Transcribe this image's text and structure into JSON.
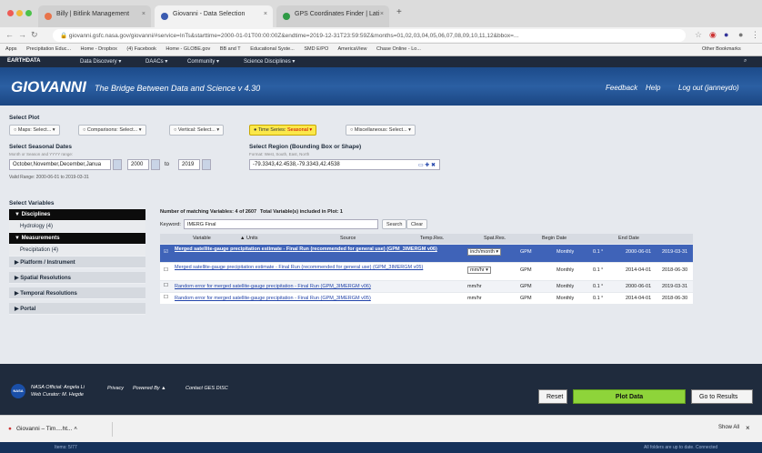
{
  "browser": {
    "tabs": [
      {
        "label": "Billy | Bitlink Management",
        "color": "#e8734a"
      },
      {
        "label": "Giovanni - Data Selection",
        "color": "#3b5bb0"
      },
      {
        "label": "GPS Coordinates Finder | Lati",
        "color": "#2e9a45"
      }
    ],
    "url": "giovanni.gsfc.nasa.gov/giovanni/#service=InTs&starttime=2000-01-01T00:00:00Z&endtime=2019-12-31T23:59:59Z&months=01,02,03,04,05,06,07,08,09,10,11,12&bbox=...",
    "bookmarks": [
      "Apps",
      "Precipitation Educ...",
      "Home - Dropbox",
      "(4) Facebook",
      "Home - GLOBE.gov",
      "BB and T",
      "Educational Syste...",
      "SMD E/PO",
      "AmericaView",
      "Chase Online - Lo..."
    ],
    "other_bookmarks": "Other Bookmarks"
  },
  "earthdata": {
    "brand": "EARTHDATA",
    "menu": [
      "Data Discovery ▾",
      "DAACs ▾",
      "Community ▾",
      "Science Disciplines ▾"
    ]
  },
  "header": {
    "title": "GIOVANNI",
    "subtitle": "The Bridge Between Data and Science",
    "version": "v 4.30",
    "links": [
      "Feedback",
      "Help",
      "Log out (janneydo)"
    ]
  },
  "plot": {
    "heading": "Select Plot",
    "options": [
      {
        "label": "Maps:",
        "select": "Select... ▾"
      },
      {
        "label": "Comparisons:",
        "select": "Select... ▾"
      },
      {
        "label": "Vertical:",
        "select": "Select... ▾"
      },
      {
        "label": "Time Series:",
        "select": "Seasonal ▾",
        "active": true
      },
      {
        "label": "Miscellaneous:",
        "select": "Select... ▾"
      }
    ]
  },
  "dates": {
    "heading": "Select Seasonal Dates",
    "hint": "Month or Season and YYYY range:",
    "season": "October,November,December,Janua",
    "start_year": "2000",
    "to": "to",
    "end_year": "2019",
    "valid": "Valid Range: 2000-06-01 to 2019-03-31"
  },
  "region": {
    "heading": "Select Region (Bounding Box or Shape)",
    "hint": "Format: West, South, East, North",
    "value": "-79.3343,42.4538,-79.3343,42.4538"
  },
  "variables": {
    "heading": "Select Variables",
    "matching": "Number of matching Variables: 4 of 2607",
    "included": "Total Variable(s) included in Plot: 1",
    "keyword_label": "Keyword:",
    "keyword": "IMERG Final",
    "search": "Search",
    "clear": "Clear",
    "sidebar": [
      {
        "label": "▼ Disciplines",
        "dark": true
      },
      {
        "label": "Hydrology (4)",
        "sub": true
      },
      {
        "label": "▼ Measurements",
        "dark": true
      },
      {
        "label": "Precipitation (4)",
        "sub": true
      },
      {
        "label": "▶ Platform / Instrument"
      },
      {
        "label": "▶ Spatial Resolutions"
      },
      {
        "label": "▶ Temporal Resolutions"
      },
      {
        "label": "▶ Portal"
      }
    ],
    "columns": [
      "Variable",
      "▲ Units",
      "Source",
      "Temp.Res.",
      "Spat.Res.",
      "Begin Date",
      "End Date"
    ],
    "rows": [
      {
        "name": "Merged satellite-gauge precipitation estimate - Final Run (recommended for general use)",
        "id": "(GPM_3IMERGM v06)",
        "units": "inch/month ▾",
        "source": "GPM",
        "temp": "Monthly",
        "spat": "0.1 °",
        "begin": "2000-06-01",
        "end": "2019-03-31",
        "selected": true
      },
      {
        "name": "Merged satellite-gauge precipitation estimate - Final Run (recommended for general use)",
        "id": "(GPM_3IMERGM v05)",
        "units": "mm/hr ▾",
        "source": "GPM",
        "temp": "Monthly",
        "spat": "0.1 °",
        "begin": "2014-04-01",
        "end": "2018-06-30"
      },
      {
        "name": "Random error for merged satellite-gauge precipitation - Final Run",
        "id": "(GPM_3IMERGM v06)",
        "units": "mm/hr",
        "source": "GPM",
        "temp": "Monthly",
        "spat": "0.1 °",
        "begin": "2000-06-01",
        "end": "2019-03-31"
      },
      {
        "name": "Random error for merged satellite-gauge precipitation - Final Run",
        "id": "(GPM_3IMERGM v05)",
        "units": "mm/hr",
        "source": "GPM",
        "temp": "Monthly",
        "spat": "0.1 °",
        "begin": "2014-04-01",
        "end": "2018-06-30"
      }
    ]
  },
  "footer": {
    "official": "NASA Official: Angela Li",
    "curator": "Web Curator: M. Hegde",
    "privacy": "Privacy",
    "powered": "Powered By ▲",
    "contact": "Contact GES DISC",
    "reset": "Reset",
    "plot": "Plot Data",
    "results": "Go to Results"
  },
  "download": {
    "file": "Giovanni – Tim....ht...",
    "show_all": "Show All"
  },
  "status": {
    "left": "Items: 5/77",
    "right": "All folders are up to date.   Connected"
  },
  "colors": {
    "header": "#1c4b8a",
    "plot_button": "#8ed43a",
    "selected_row": "#3f63b8"
  }
}
